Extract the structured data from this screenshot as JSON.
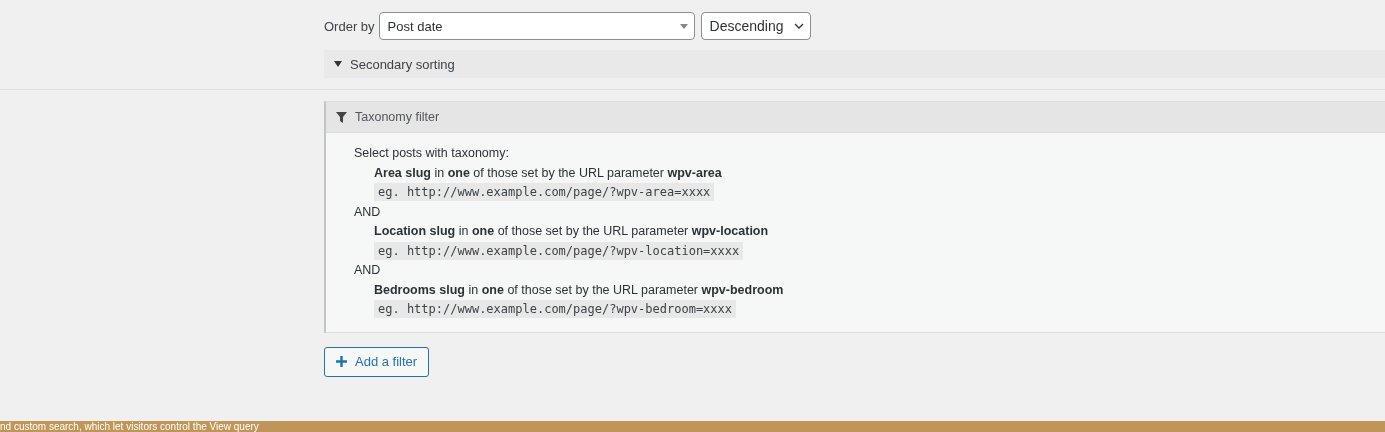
{
  "order": {
    "label": "Order by",
    "field": "Post date",
    "direction": "Descending"
  },
  "secondary_sorting": {
    "label": "Secondary sorting",
    "expanded": true
  },
  "taxonomy_filter": {
    "title": "Taxonomy filter",
    "intro": "Select posts with taxonomy:",
    "conditions": [
      {
        "rule": "**Area slug** in **one** of those set by the URL parameter **wpv-area**",
        "example": "eg. http://www.example.com/page/?wpv-area=xxxx"
      },
      {
        "connector": "AND",
        "rule": "**Location slug** in **one** of those set by the URL parameter **wpv-location**",
        "example": "eg. http://www.example.com/page/?wpv-location=xxxx"
      },
      {
        "connector": "AND",
        "rule": "**Bedrooms slug** in **one** of those set by the URL parameter **wpv-bedroom**",
        "example": "eg. http://www.example.com/page/?wpv-bedroom=xxxx"
      }
    ]
  },
  "add_filter_button": "Add a filter",
  "footer_notice": "nd custom search, which let visitors control the View query"
}
